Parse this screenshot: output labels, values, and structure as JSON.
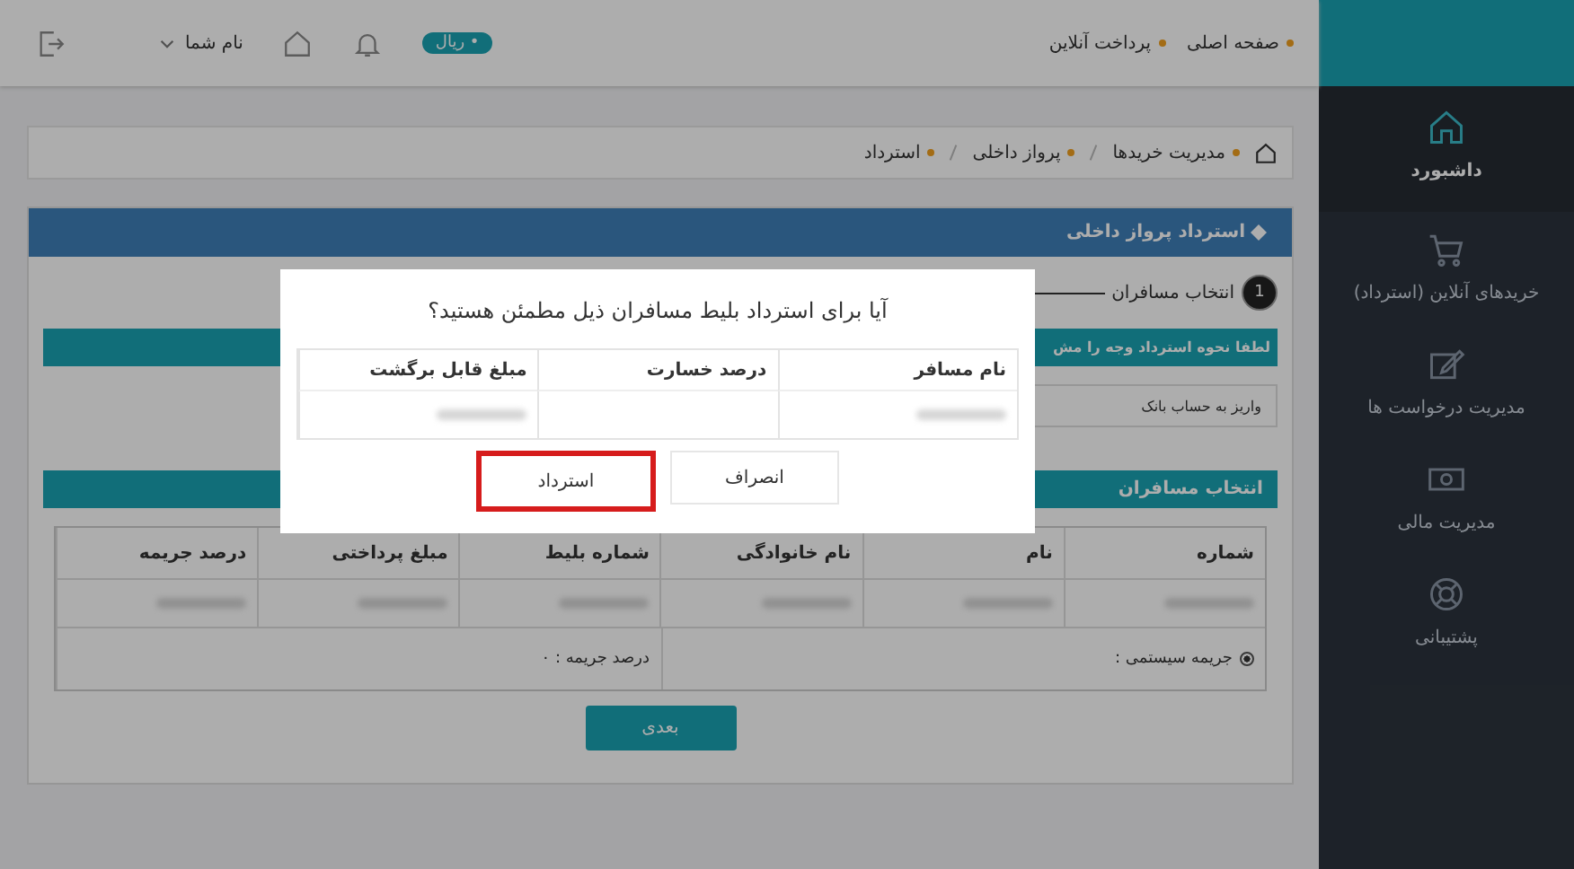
{
  "header": {
    "nav": [
      "صفحه اصلی",
      "پرداخت آنلاین"
    ],
    "currency_badge": "• ریال",
    "user_menu": "نام شما"
  },
  "sidebar": {
    "items": [
      {
        "label": "داشبورد",
        "selected": true
      },
      {
        "label": "خریدهای آنلاین (استرداد)",
        "selected": false
      },
      {
        "label": "مدیریت درخواست ها",
        "selected": false
      },
      {
        "label": "مدیریت مالی",
        "selected": false
      },
      {
        "label": "پشتیبانی",
        "selected": false
      }
    ]
  },
  "breadcrumb": [
    "مدیریت خریدها",
    "پرواز داخلی",
    "استرداد"
  ],
  "panel": {
    "title": "استرداد پرواز داخلی",
    "steps": [
      {
        "number": "1",
        "label": "انتخاب مسافران",
        "selected": true
      }
    ],
    "refund_method_bar": "لطفا نحوه استرداد وجه را مش",
    "refund_method_value": "واریز به حساب بانک",
    "passengers_bar": "انتخاب مسافران",
    "table": {
      "columns": [
        "شماره",
        "نام",
        "نام خانوادگی",
        "شماره بلیط",
        "مبلغ پرداختی",
        "درصد جریمه"
      ]
    },
    "penalty_option": {
      "label": "جریمه سیستمی :",
      "selected": true
    },
    "penalty_percent": "درصد جریمه : ۰",
    "next_button": "بعدی"
  },
  "modal": {
    "question": "آیا برای استرداد بلیط مسافران ذیل مطمئن هستید؟",
    "columns": [
      "نام مسافر",
      "درصد خسارت",
      "مبلغ قابل برگشت"
    ],
    "buttons": [
      {
        "label": "انصراف",
        "highlighted": false
      },
      {
        "label": "استرداد",
        "highlighted": true
      }
    ]
  }
}
